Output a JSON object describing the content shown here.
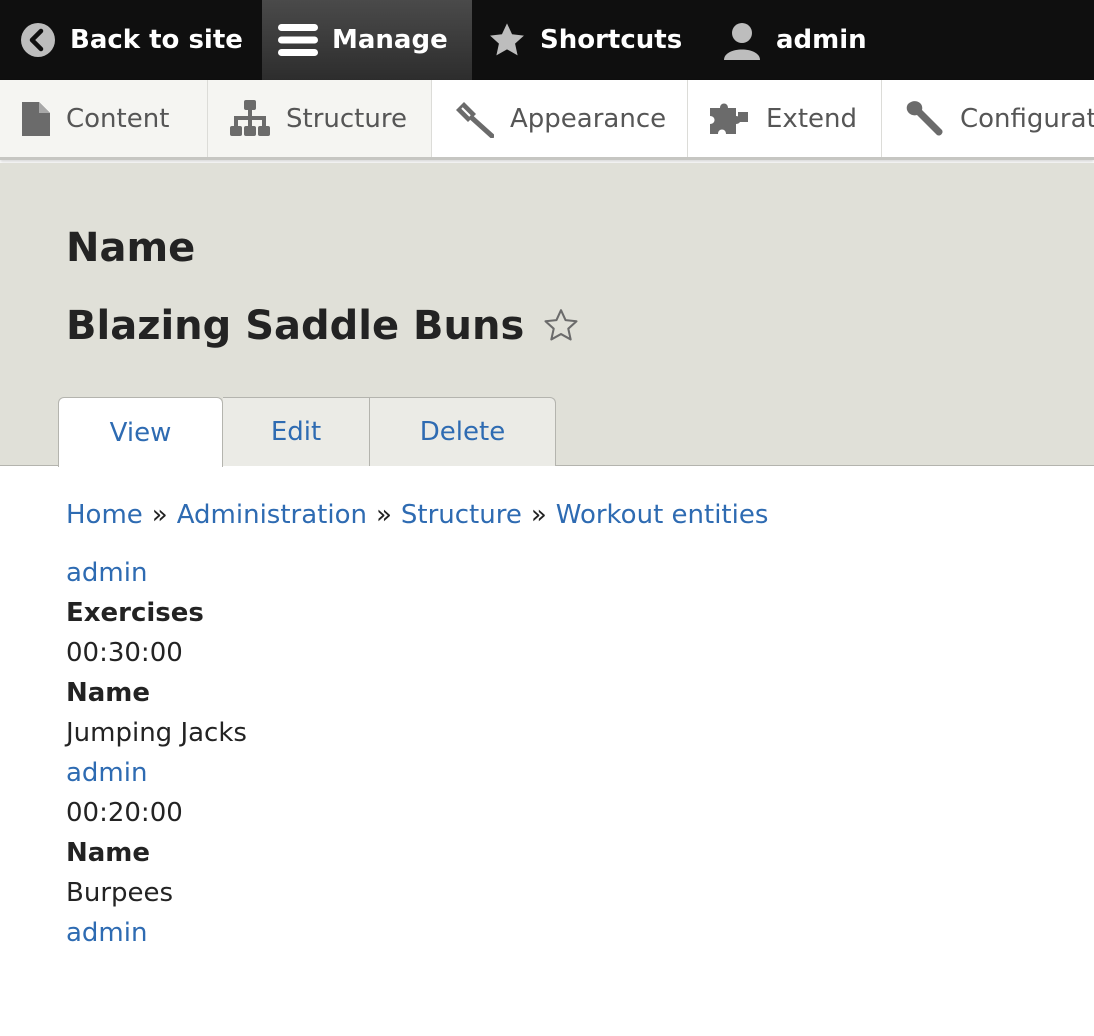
{
  "toolbar": {
    "back_label": "Back to site",
    "manage_label": "Manage",
    "shortcuts_label": "Shortcuts",
    "user_label": "admin"
  },
  "tray": {
    "items": [
      {
        "label": "Content",
        "icon": "file-icon"
      },
      {
        "label": "Structure",
        "icon": "sitemap-icon"
      },
      {
        "label": "Appearance",
        "icon": "paintbrush-icon"
      },
      {
        "label": "Extend",
        "icon": "puzzle-icon"
      },
      {
        "label": "Configuration",
        "icon": "wrench-icon"
      }
    ]
  },
  "header": {
    "label": "Name",
    "title": "Blazing Saddle Buns",
    "tabs": [
      {
        "label": "View",
        "active": true
      },
      {
        "label": "Edit",
        "active": false
      },
      {
        "label": "Delete",
        "active": false
      }
    ]
  },
  "breadcrumb": {
    "items": [
      "Home",
      "Administration",
      "Structure",
      "Workout entities"
    ],
    "separator": "»"
  },
  "fields": {
    "author_1": "admin",
    "exercises_label": "Exercises",
    "duration_1": "00:30:00",
    "name_label_1": "Name",
    "name_1": "Jumping Jacks",
    "author_2": "admin",
    "duration_2": "00:20:00",
    "name_label_2": "Name",
    "name_2": "Burpees",
    "author_3": "admin"
  },
  "colors": {
    "toolbar_bg": "#0f0f0f",
    "header_bg": "#e0e0d8",
    "link": "#2e6bb2"
  }
}
